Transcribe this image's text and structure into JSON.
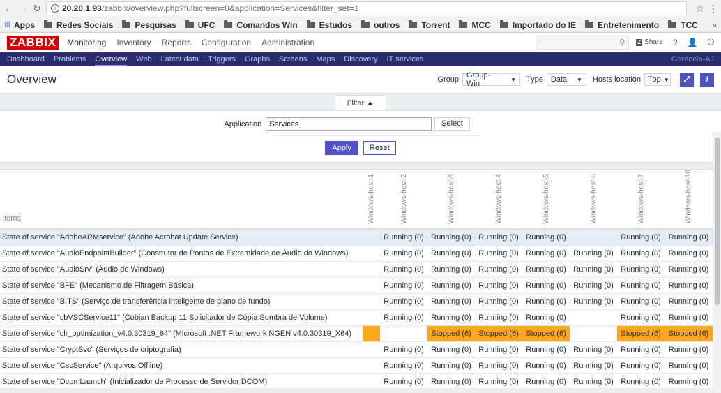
{
  "browser": {
    "url_main": "20.20.1.93",
    "url_rest": "/zabbix/overview.php?fullscreen=0&application=Services&filter_set=1"
  },
  "bookmarks": {
    "apps": "Apps",
    "items": [
      "Redes Sociais",
      "Pesquisas",
      "UFC",
      "Comandos Win",
      "Estudos",
      "outros",
      "Torrent",
      "MCC",
      "Importado do IE",
      "Entretenimento",
      "TCC"
    ],
    "more": "»"
  },
  "topnav": {
    "logo": "ZABBIX",
    "menu": [
      "Monitoring",
      "Inventory",
      "Reports",
      "Configuration",
      "Administration"
    ],
    "share": "Share",
    "help": "?"
  },
  "subnav": {
    "items": [
      "Dashboard",
      "Problems",
      "Overview",
      "Web",
      "Latest data",
      "Triggers",
      "Graphs",
      "Screens",
      "Maps",
      "Discovery",
      "IT services"
    ],
    "active": "Overview",
    "right": "Gerencia-AJ"
  },
  "header": {
    "title": "Overview",
    "group_label": "Group",
    "group_value": "Group-Win",
    "type_label": "Type",
    "type_value": "Data",
    "hosts_label": "Hosts location",
    "hosts_value": "Top"
  },
  "filter": {
    "tab": "Filter ▲",
    "app_label": "Application",
    "app_value": "Services",
    "select": "Select",
    "apply": "Apply",
    "reset": "Reset"
  },
  "table": {
    "items_header": "Items",
    "hosts": [
      "Windows-host-1",
      "Windows-host-2",
      "Windows-host-3",
      "Windows-host-4",
      "Windows-host-5",
      "Windows-host-6",
      "Windows-host-7",
      "Windows-host-10"
    ],
    "rows": [
      {
        "item": "State of service \"AdobeARMservice\" (Adobe Acrobat Update Service)",
        "vals": [
          "",
          "Running (0)",
          "Running (0)",
          "Running (0)",
          "Running (0)",
          "",
          "Running (0)",
          "Running (0)"
        ],
        "highlight": true
      },
      {
        "item": "State of service \"AudioEndpointBuilder\" (Construtor de Pontos de Extremidade de Áudio do Windows)",
        "vals": [
          "",
          "Running (0)",
          "Running (0)",
          "Running (0)",
          "Running (0)",
          "Running (0)",
          "Running (0)",
          "Running (0)"
        ]
      },
      {
        "item": "State of service \"AudioSrv\" (Áudio do Windows)",
        "vals": [
          "",
          "Running (0)",
          "Running (0)",
          "Running (0)",
          "Running (0)",
          "Running (0)",
          "Running (0)",
          "Running (0)"
        ]
      },
      {
        "item": "State of service \"BFE\" (Mecanismo de Filtragem Básica)",
        "vals": [
          "",
          "Running (0)",
          "Running (0)",
          "Running (0)",
          "Running (0)",
          "Running (0)",
          "Running (0)",
          "Running (0)"
        ]
      },
      {
        "item": "State of service \"BITS\" (Serviço de transferência inteligente de plano de fundo)",
        "vals": [
          "",
          "Running (0)",
          "Running (0)",
          "Running (0)",
          "Running (0)",
          "Running (0)",
          "Running (0)",
          "Running (0)"
        ]
      },
      {
        "item": "State of service \"cbVSCService11\" (Cobian Backup 11 Solicitador de Cópia Sombra de Volume)",
        "vals": [
          "",
          "Running (0)",
          "Running (0)",
          "Running (0)",
          "Running (0)",
          "",
          "Running (0)",
          "Running (0)"
        ]
      },
      {
        "item": "State of service \"clr_optimization_v4.0.30319_64\" (Microsoft .NET Framework NGEN v4.0.30319_X64)",
        "vals": [
          "#orange",
          "",
          "Stopped (6)",
          "Stopped (6)",
          "Stopped (6)",
          "",
          "Stopped (6)",
          "Stopped (6)"
        ]
      },
      {
        "item": "State of service \"CryptSvc\" (Serviços de criptografia)",
        "vals": [
          "",
          "Running (0)",
          "Running (0)",
          "Running (0)",
          "Running (0)",
          "Running (0)",
          "Running (0)",
          "Running (0)"
        ]
      },
      {
        "item": "State of service \"CscService\" (Arquivos Offline)",
        "vals": [
          "",
          "Running (0)",
          "Running (0)",
          "Running (0)",
          "Running (0)",
          "Running (0)",
          "Running (0)",
          "Running (0)"
        ]
      },
      {
        "item": "State of service \"DcomLaunch\" (Inicializador de Processo de Servidor DCOM)",
        "vals": [
          "",
          "Running (0)",
          "Running (0)",
          "Running (0)",
          "Running (0)",
          "Running (0)",
          "Running (0)",
          "Running (0)"
        ]
      }
    ]
  },
  "colors": {
    "problem": "#ffa71a",
    "accent": "#4e52c6",
    "subnav": "#2b2c6e"
  }
}
